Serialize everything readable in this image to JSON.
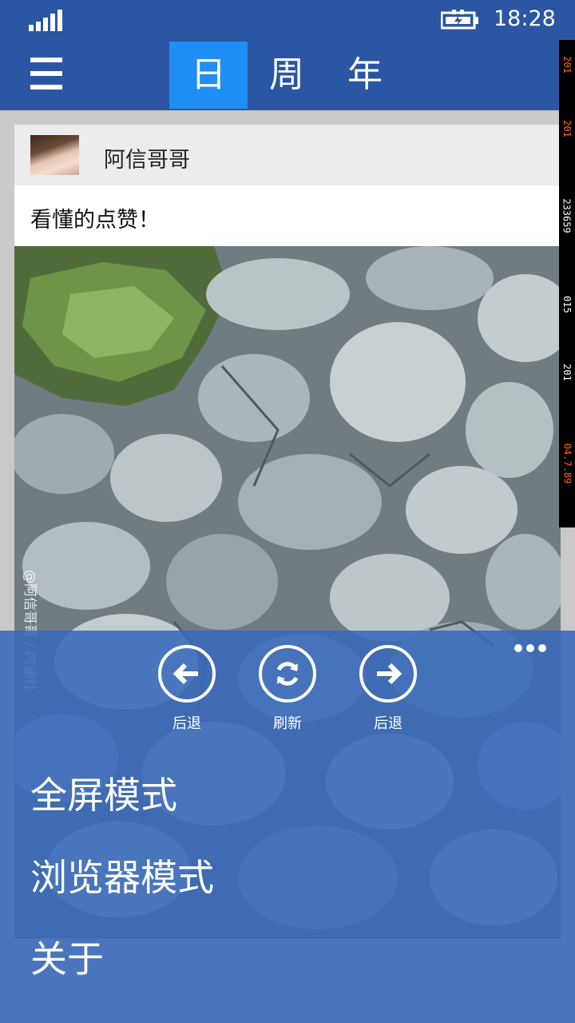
{
  "status_bar": {
    "time": "18:28",
    "signal_icon": "signal-bars-icon",
    "battery_icon": "battery-charging-icon"
  },
  "header": {
    "menu_icon": "hamburger-menu-icon",
    "tabs": [
      {
        "label": "日",
        "active": true
      },
      {
        "label": "周",
        "active": false
      },
      {
        "label": "年",
        "active": false
      }
    ],
    "background_color": "#2b56a3",
    "active_tab_color": "#1f8ef5"
  },
  "post": {
    "author": "阿信哥哥",
    "text": "看懂的点赞！",
    "image_watermark": "@阿信哥哥 / 内涵社"
  },
  "side_strip": [
    "201",
    "201",
    "233659",
    "015",
    "201",
    "04.7.89"
  ],
  "app_bar": {
    "buttons": [
      {
        "label": "后退",
        "icon": "arrow-left-icon"
      },
      {
        "label": "刷新",
        "icon": "refresh-icon"
      },
      {
        "label": "后退",
        "icon": "arrow-right-icon"
      }
    ],
    "more_icon": "ellipsis-icon",
    "menu_items": [
      "全屏模式",
      "浏览器模式",
      "关于"
    ],
    "background_color": "#3668ba"
  }
}
